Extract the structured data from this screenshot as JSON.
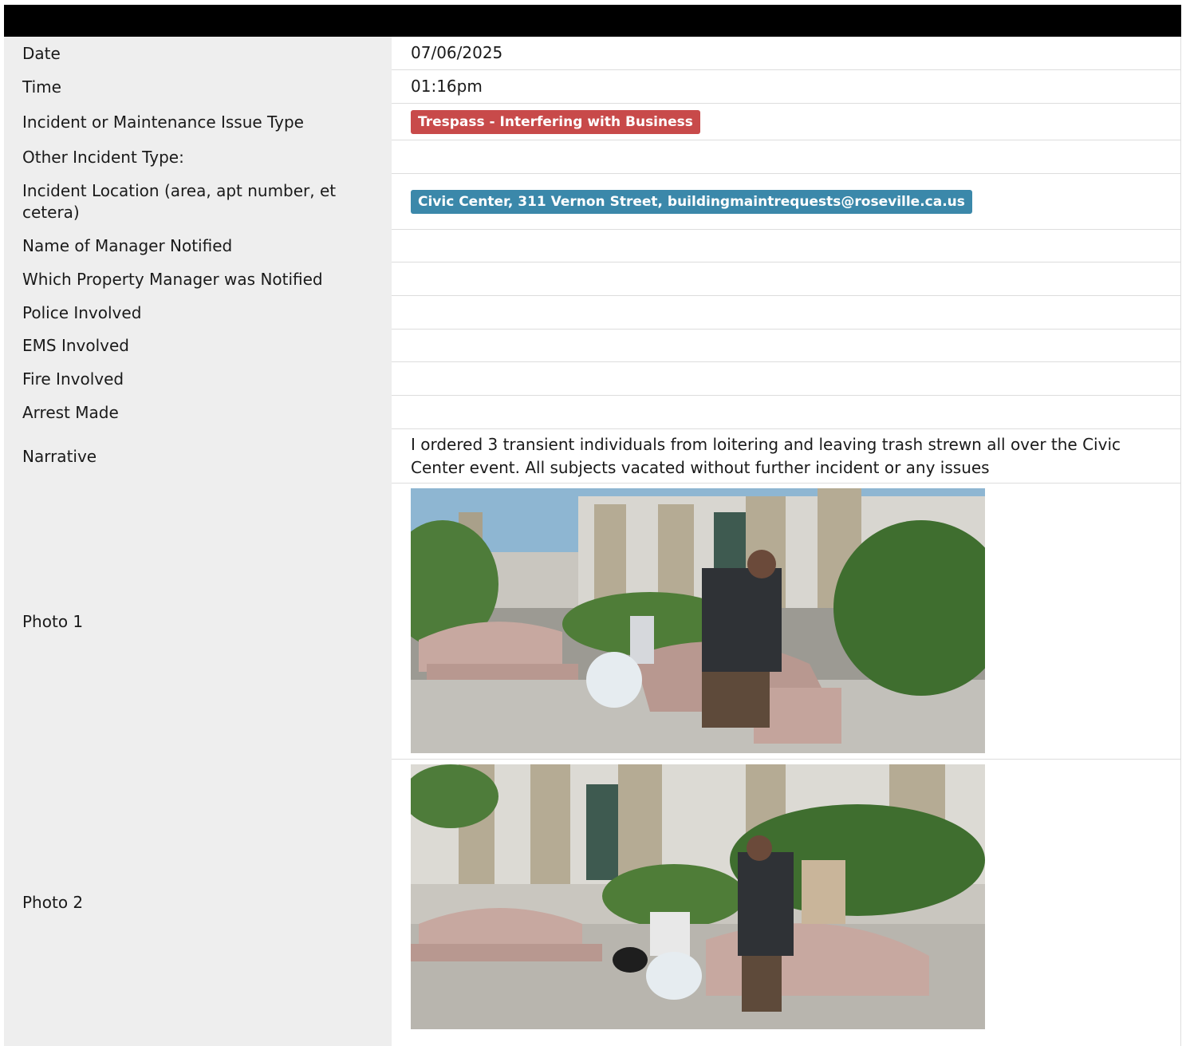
{
  "header": {
    "title": ""
  },
  "fields": {
    "date": {
      "label": "Date",
      "value": "07/06/2025"
    },
    "time": {
      "label": "Time",
      "value": "01:16pm"
    },
    "issue_type": {
      "label": "Incident or Maintenance Issue Type",
      "value": "Trespass - Interfering with Business",
      "badge_color": "#c84a4a"
    },
    "other_type": {
      "label": "Other Incident Type:",
      "value": ""
    },
    "location": {
      "label": "Incident Location (area, apt number, et cetera)",
      "value": "Civic Center, 311 Vernon Street, buildingmaintrequests@roseville.ca.us",
      "badge_color": "#3b88aa"
    },
    "manager_name": {
      "label": "Name of Manager Notified",
      "value": ""
    },
    "property_manager": {
      "label": "Which Property Manager was Notified",
      "value": ""
    },
    "police": {
      "label": "Police Involved",
      "value": ""
    },
    "ems": {
      "label": "EMS Involved",
      "value": ""
    },
    "fire": {
      "label": "Fire Involved",
      "value": ""
    },
    "arrest": {
      "label": "Arrest Made",
      "value": ""
    },
    "narrative": {
      "label": "Narrative",
      "value": "I ordered 3 transient individuals from loitering and leaving trash strewn all over the Civic Center event. All subjects vacated without further incident or any issues"
    },
    "photo1": {
      "label": "Photo 1"
    },
    "photo2": {
      "label": "Photo 2"
    }
  },
  "colors": {
    "header": "#000000",
    "label_bg": "#eeeeee",
    "divider": "#dddddd"
  }
}
